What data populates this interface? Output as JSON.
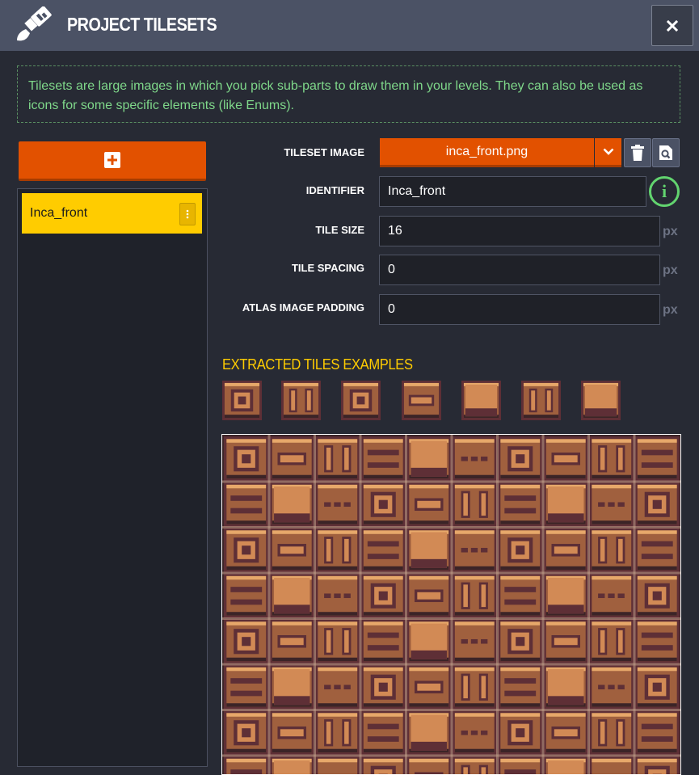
{
  "window": {
    "title": "PROJECT TILESETS",
    "title_icon": "paint-brush-icon",
    "close_icon": "close-icon"
  },
  "info": {
    "text": "Tilesets are large images in which you pick sub-parts to draw them in your levels. They can also be used as icons for some specific elements (like Enums)."
  },
  "sidebar": {
    "add_icon": "plus-icon",
    "items": [
      {
        "label": "Inca_front",
        "selected": true,
        "menu_icon": "more-vertical-icon"
      }
    ]
  },
  "form": {
    "tileset_image": {
      "label": "TILESET IMAGE",
      "value": "inca_front.png",
      "caret_icon": "chevron-down-icon",
      "delete_icon": "trash-icon",
      "locate_icon": "search-file-icon"
    },
    "identifier": {
      "label": "IDENTIFIER",
      "value": "Inca_front",
      "help_icon": "info-icon",
      "help_glyph": "i"
    },
    "tile_size": {
      "label": "TILE SIZE",
      "value": "16",
      "unit": "px"
    },
    "tile_spacing": {
      "label": "TILE SPACING",
      "value": "0",
      "unit": "px"
    },
    "atlas_padding": {
      "label": "ATLAS IMAGE PADDING",
      "value": "0",
      "unit": "px"
    }
  },
  "tiles": {
    "title": "EXTRACTED TILES EXAMPLES",
    "count": 7
  },
  "colors": {
    "accent": "#e25100",
    "selected": "#ffcc00",
    "info_text": "#7fd88a",
    "titlebar": "#4b5265"
  }
}
